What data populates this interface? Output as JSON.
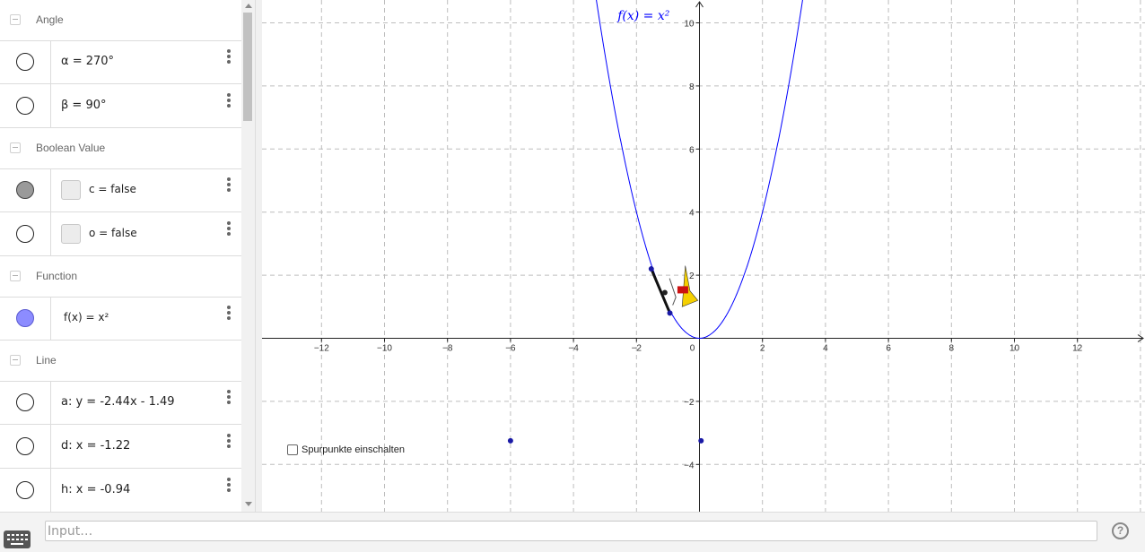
{
  "algebra": {
    "categories": {
      "angle": "Angle",
      "boolean": "Boolean Value",
      "function": "Function",
      "line": "Line"
    },
    "items": {
      "alpha": "α = 270°",
      "beta": "β = 90°",
      "c": "c = false",
      "o": "o = false",
      "f": "f(x) = x²",
      "a": "a: y = -2.44x - 1.49",
      "d": "d: x = -1.22",
      "h": "h: x = -0.94"
    }
  },
  "graphics": {
    "function_label": "f(x) = x²",
    "trace_checkbox_label": "Spurpunkte einschalten",
    "x_ticks": [
      "−12",
      "−10",
      "−8",
      "−6",
      "−4",
      "−2",
      "0",
      "2",
      "4",
      "6",
      "8",
      "10",
      "12"
    ],
    "y_ticks": [
      "−4",
      "−2",
      "2",
      "4",
      "6",
      "8",
      "10"
    ],
    "curve_color": "#0000ff",
    "point_color": "#1a1aa6",
    "points": [
      {
        "x": -6,
        "y": -3.25
      },
      {
        "x": 0.05,
        "y": -3.25
      }
    ],
    "lamp_segment": {
      "from": {
        "x": -1.53,
        "y": 2.2
      },
      "to": {
        "x": -0.94,
        "y": 0.8
      }
    }
  },
  "input_bar": {
    "placeholder": "Input…",
    "help_label": "?"
  }
}
